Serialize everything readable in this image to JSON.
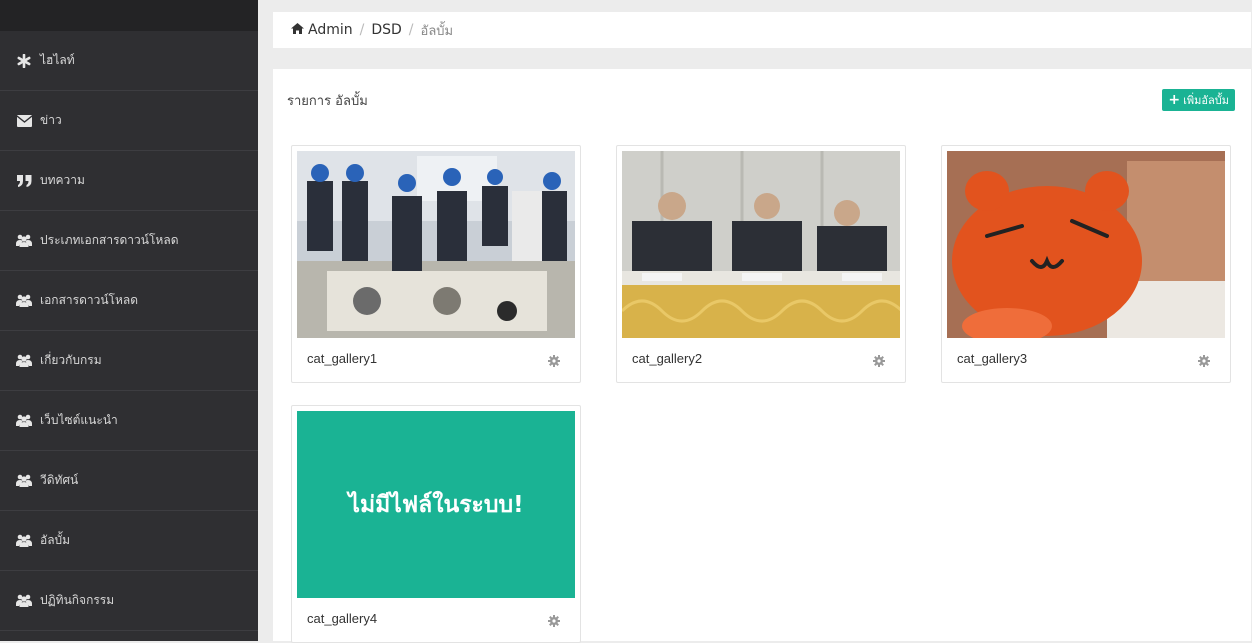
{
  "sidebar": {
    "items": [
      {
        "label": "ไฮไลท์",
        "icon": "asterisk-icon"
      },
      {
        "label": "ข่าว",
        "icon": "envelope-icon"
      },
      {
        "label": "บทความ",
        "icon": "quote-icon"
      },
      {
        "label": "ประเภทเอกสารดาวน์โหลด",
        "icon": "users-icon"
      },
      {
        "label": "เอกสารดาวน์โหลด",
        "icon": "users-icon"
      },
      {
        "label": "เกี่ยวกับกรม",
        "icon": "users-icon"
      },
      {
        "label": "เว็บไซต์แนะนำ",
        "icon": "users-icon"
      },
      {
        "label": "วีดิทัศน์",
        "icon": "users-icon"
      },
      {
        "label": "อัลบั้ม",
        "icon": "users-icon"
      },
      {
        "label": "ปฏิทินกิจกรรม",
        "icon": "users-icon"
      }
    ]
  },
  "breadcrumb": {
    "home": "Admin",
    "section": "DSD",
    "current": "อัลบั้ม",
    "separator": "/"
  },
  "panel": {
    "title": "รายการ อัลบั้ม",
    "add_button": "เพิ่มอัลบั้ม"
  },
  "albums": [
    {
      "name": "cat_gallery1",
      "image": "photo"
    },
    {
      "name": "cat_gallery2",
      "image": "photo"
    },
    {
      "name": "cat_gallery3",
      "image": "photo"
    },
    {
      "name": "cat_gallery4",
      "image": "placeholder",
      "placeholder_text": "ไม่มีไฟล์ในระบบ!"
    }
  ],
  "colors": {
    "accent": "#1ab394",
    "sidebar_bg": "#2f2f32",
    "page_bg": "#ececec"
  }
}
